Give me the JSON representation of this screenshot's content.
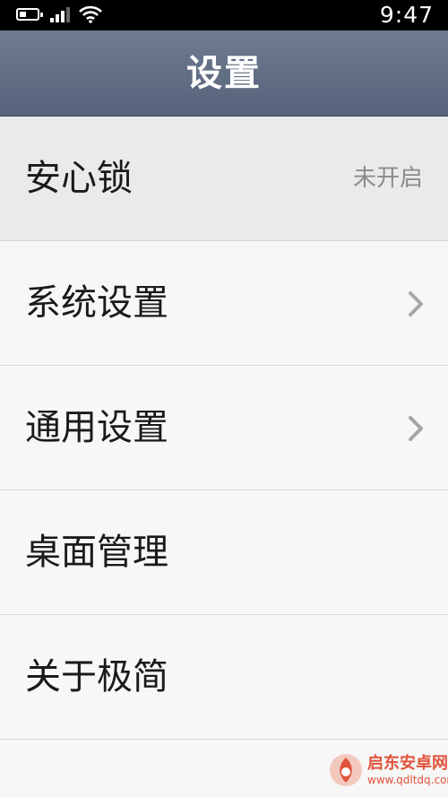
{
  "status_bar": {
    "time": "9:47",
    "battery_level": 0.2,
    "signal_bars": 3,
    "icons": [
      "battery-icon",
      "signal-icon",
      "wifi-icon"
    ]
  },
  "header": {
    "title": "设置",
    "background_color": "#5f6b80"
  },
  "settings": {
    "items": [
      {
        "label": "安心锁",
        "value": "未开启",
        "has_chevron": false
      },
      {
        "label": "系统设置",
        "value": "",
        "has_chevron": true
      },
      {
        "label": "通用设置",
        "value": "",
        "has_chevron": true
      },
      {
        "label": "桌面管理",
        "value": "",
        "has_chevron": false
      },
      {
        "label": "关于极简",
        "value": "",
        "has_chevron": false
      }
    ]
  },
  "watermark": {
    "name": "启东安卓网",
    "url": "www.qdltdq.com",
    "icon": "watermark-logo-icon",
    "color": "#e0533b"
  }
}
